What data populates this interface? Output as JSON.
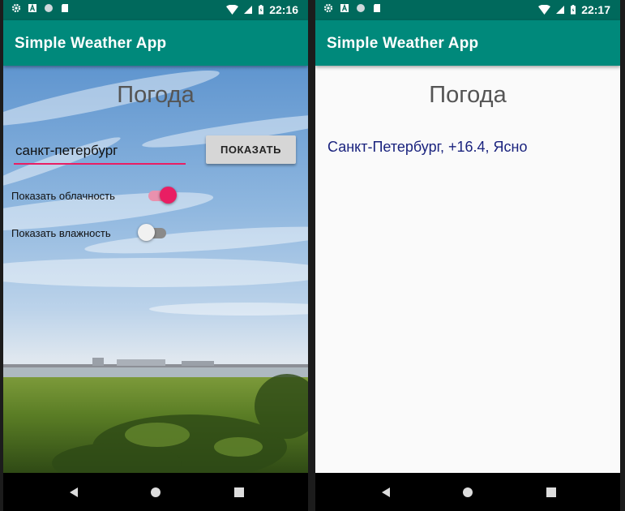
{
  "status_left": {
    "time": "22:16"
  },
  "status_right": {
    "time": "22:17"
  },
  "app": {
    "title": "Simple Weather App"
  },
  "main_screen": {
    "heading": "Погода",
    "city_input_value": "санкт-петербург",
    "show_button_label": "ПОКАЗАТЬ",
    "cloudiness_label": "Показать облачность",
    "cloudiness_on": true,
    "humidity_label": "Показать влажность",
    "humidity_on": false
  },
  "result_screen": {
    "heading": "Погода",
    "result_text": "Санкт-Петербург, +16.4, Ясно"
  },
  "colors": {
    "status_bar": "#00695c",
    "app_bar": "#00897b",
    "accent": "#e91e63",
    "result_text": "#1a237e"
  },
  "icons": [
    "settings-icon",
    "a-box-icon",
    "circle-icon",
    "sd-card-icon",
    "wifi-icon",
    "signal-icon",
    "battery-icon",
    "back-icon",
    "home-icon",
    "recents-icon"
  ]
}
